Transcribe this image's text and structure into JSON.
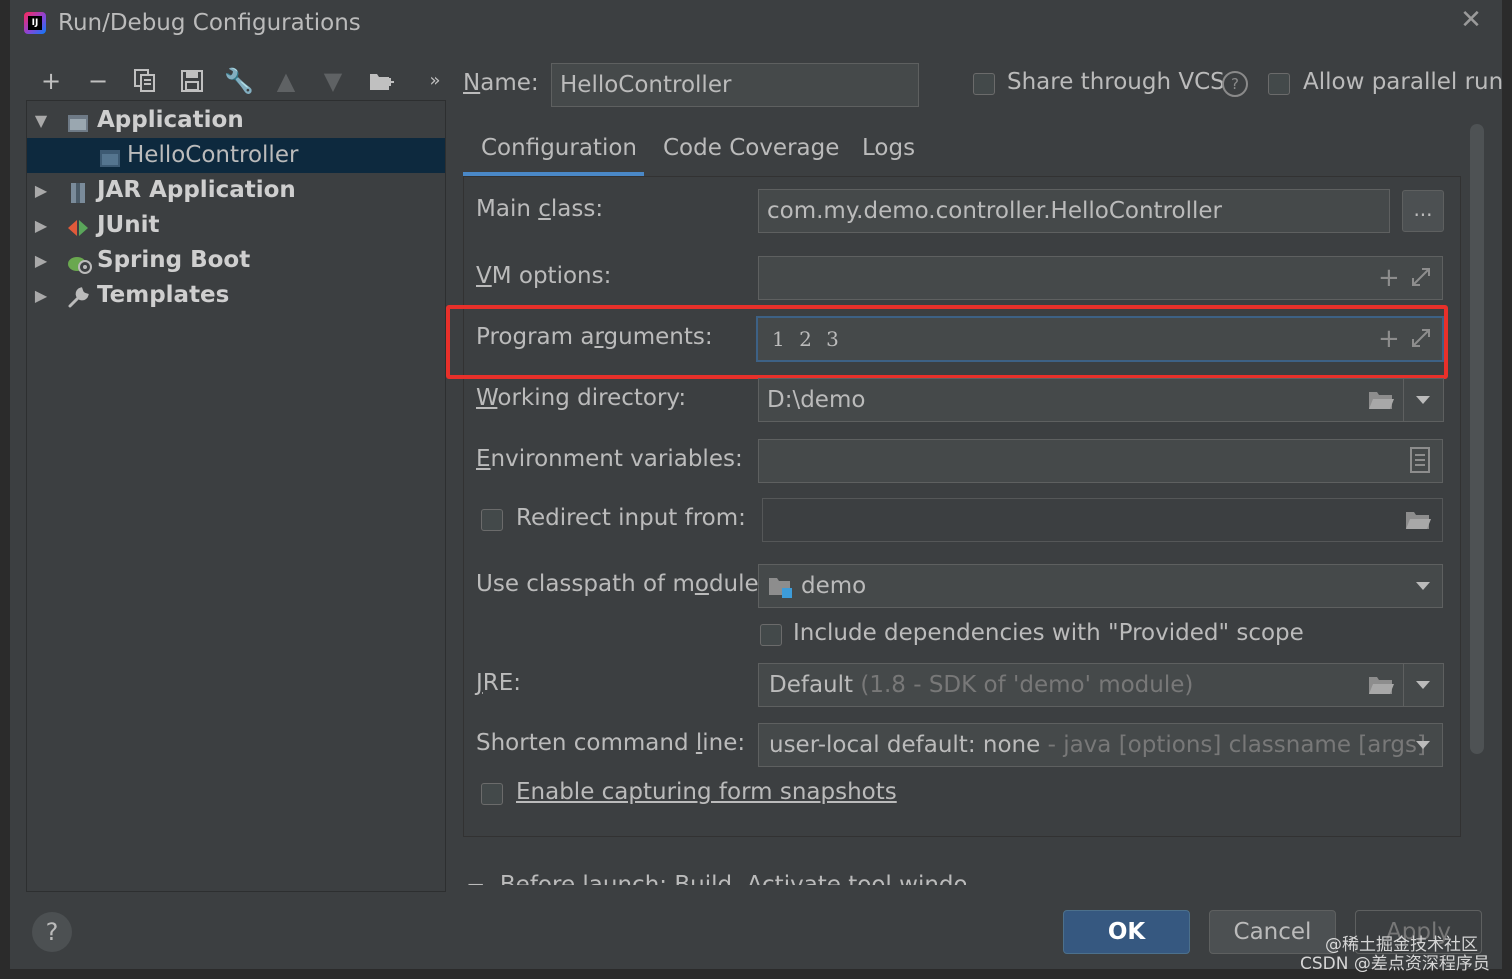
{
  "window": {
    "title": "Run/Debug Configurations",
    "app_icon": "intellij-idea-icon",
    "close_icon": "close-icon"
  },
  "toolbar": {
    "icons": [
      "add-icon",
      "remove-icon",
      "copy-icon",
      "save-icon",
      "wrench-icon",
      "move-up-icon",
      "move-down-icon",
      "new-folder-icon",
      "more-icon"
    ]
  },
  "tree": {
    "items": [
      {
        "label": "Application",
        "expanded": true
      },
      {
        "label": "HelloController",
        "selected": true
      },
      {
        "label": "JAR Application"
      },
      {
        "label": "JUnit"
      },
      {
        "label": "Spring Boot"
      },
      {
        "label": "Templates"
      }
    ]
  },
  "header": {
    "name_label": "Name:",
    "name_value": "HelloController",
    "share_vcs_label": "Share through VCS",
    "share_vcs_checked": false,
    "allow_parallel_label": "Allow parallel run",
    "allow_parallel_checked": false
  },
  "tabs": [
    {
      "label": "Configuration",
      "active": true
    },
    {
      "label": "Code Coverage"
    },
    {
      "label": "Logs"
    }
  ],
  "form": {
    "main_class_label": "Main class:",
    "main_class_value": "com.my.demo.controller.HelloController",
    "browse_label": "...",
    "vm_options_label": "VM options:",
    "vm_options_value": "",
    "program_args_label": "Program arguments:",
    "program_args_value": "1 2 3",
    "working_dir_label": "Working directory:",
    "working_dir_value": "D:\\demo",
    "env_vars_label": "Environment variables:",
    "env_vars_value": "",
    "redirect_label": "Redirect input from:",
    "redirect_checked": false,
    "redirect_value": "",
    "classpath_label": "Use classpath of module:",
    "classpath_value": "demo",
    "include_deps_label": "Include dependencies with \"Provided\" scope",
    "include_deps_checked": false,
    "jre_label": "JRE:",
    "jre_value": "Default",
    "jre_hint": "(1.8 - SDK of 'demo' module)",
    "shorten_label": "Shorten command line:",
    "shorten_value": "user-local default: none",
    "shorten_hint": "- java [options] classname [args]",
    "snapshots_label": "Enable capturing form snapshots",
    "snapshots_checked": false,
    "before_launch": "Before launch: Build, Activate tool window"
  },
  "footer": {
    "help_label": "?",
    "ok_label": "OK",
    "cancel_label": "Cancel",
    "apply_label": "Apply"
  },
  "watermark": {
    "line1": "@稀土掘金技术社区",
    "line2": "CSDN @差点资深程序员"
  },
  "colors": {
    "background": "#3c3f41",
    "selection": "#0d293e",
    "accent": "#4a88c7",
    "highlight_box": "#e8302a",
    "ok_button": "#365880"
  }
}
